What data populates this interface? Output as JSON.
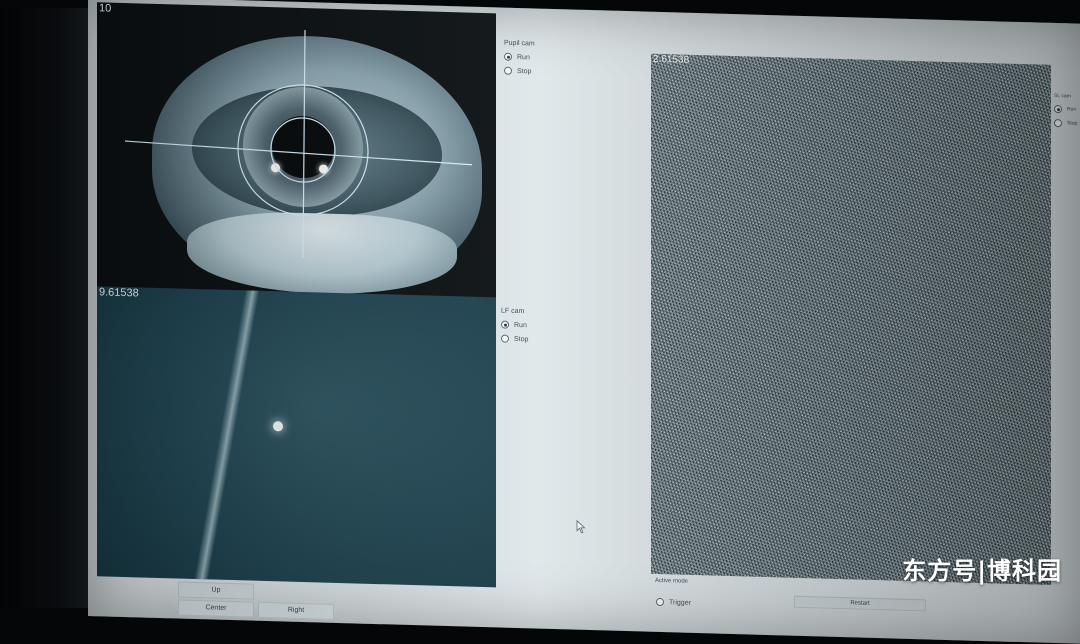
{
  "pupil_cam": {
    "readout": "10",
    "group_title": "Pupil cam",
    "run_label": "Run",
    "stop_label": "Stop",
    "selected": "Run"
  },
  "lf_cam": {
    "readout": "9.61538",
    "group_title": "LF cam",
    "run_label": "Run",
    "stop_label": "Stop",
    "selected": "Run"
  },
  "slm_view": {
    "readout": "2.61538",
    "group_title": "SL cam",
    "run_label": "Run",
    "stop_label": "Stop"
  },
  "nav_buttons": {
    "up": "Up",
    "center": "Center",
    "right": "Right"
  },
  "active_mode_label": "Active mode",
  "trigger_label": "Trigger",
  "restart_label": "Restart",
  "watermark": "东方号|博科园",
  "colors": {
    "screen_bg": "#dfe7ea",
    "crosshair": "#d9f0ff",
    "noise_base": "#6f8e99"
  }
}
